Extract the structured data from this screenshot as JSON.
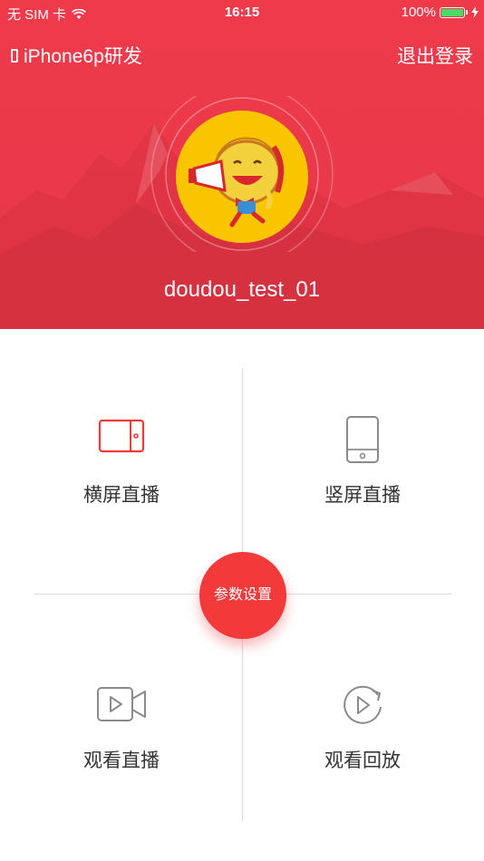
{
  "status_bar": {
    "carrier": "无 SIM 卡",
    "time": "16:15",
    "battery_percent": "100%",
    "battery_level": 1.0,
    "battery_color": "#4cd964"
  },
  "nav": {
    "device_name": "iPhone6p研发",
    "logout_label": "退出登录"
  },
  "profile": {
    "username": "doudou_test_01",
    "avatar_bg": "#f9c500"
  },
  "theme": {
    "header_red": "#ed3a4a",
    "accent_red": "#f23a3b"
  },
  "menu": {
    "landscape_live": {
      "label": "横屏直播",
      "icon": "landscape-phone-icon"
    },
    "portrait_live": {
      "label": "竖屏直播",
      "icon": "portrait-phone-icon"
    },
    "watch_live": {
      "label": "观看直播",
      "icon": "video-camera-icon"
    },
    "watch_replay": {
      "label": "观看回放",
      "icon": "replay-icon"
    },
    "settings_label": "参数设置"
  }
}
